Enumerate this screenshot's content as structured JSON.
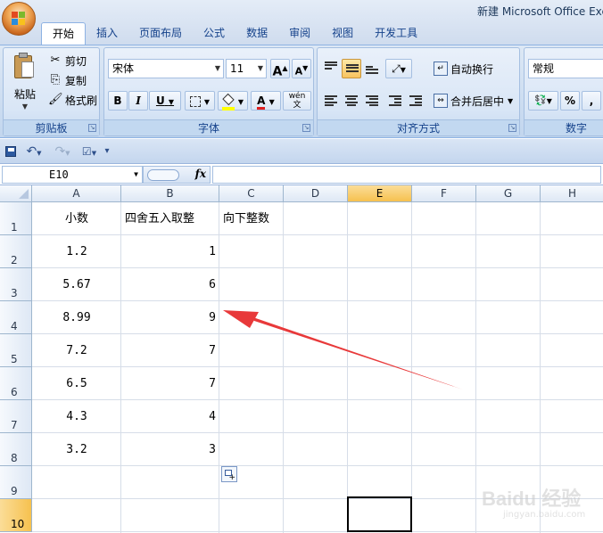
{
  "window": {
    "title": "新建 Microsoft Office Exc"
  },
  "tabs": [
    "开始",
    "插入",
    "页面布局",
    "公式",
    "数据",
    "审阅",
    "视图",
    "开发工具"
  ],
  "ribbon": {
    "clipboard": {
      "paste": "粘贴",
      "cut": "剪切",
      "copy": "复制",
      "format_painter": "格式刷",
      "label": "剪贴板"
    },
    "font": {
      "name": "宋体",
      "size": "11",
      "label": "字体",
      "grow": "A",
      "shrink": "A",
      "bold": "B",
      "italic": "I",
      "underline": "U",
      "font_color": "A",
      "phonetic": "wén 文"
    },
    "alignment": {
      "wrap_text": "自动换行",
      "merge_center": "合并后居中",
      "label": "对齐方式"
    },
    "number": {
      "format": "常规",
      "percent": "%",
      "comma": ",",
      "label": "数字"
    }
  },
  "formula_bar": {
    "name_box": "E10",
    "fx": "fx",
    "content": ""
  },
  "sheet": {
    "columns": [
      "A",
      "B",
      "C",
      "D",
      "E",
      "F",
      "G",
      "H"
    ],
    "rows": [
      "1",
      "2",
      "3",
      "4",
      "5",
      "6",
      "7",
      "8",
      "9",
      "10"
    ],
    "selected_cell": "E10",
    "headers": {
      "A": "小数",
      "B": "四舍五入取整",
      "C": "向下整数"
    },
    "col_a": [
      "1.2",
      "5.67",
      "8.99",
      "7.2",
      "6.5",
      "4.3",
      "3.2"
    ],
    "col_b": [
      "1",
      "6",
      "9",
      "7",
      "7",
      "4",
      "3"
    ]
  },
  "annotation": {
    "color": "#e8393a"
  },
  "watermark": {
    "main": "Baidu 经验",
    "sub": "jingyan.baidu.com"
  }
}
